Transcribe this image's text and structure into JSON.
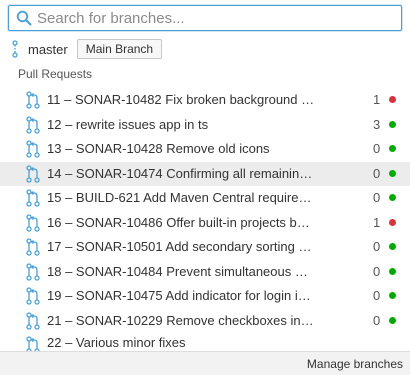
{
  "search": {
    "placeholder": "Search for branches..."
  },
  "current_branch": {
    "name": "master",
    "badge": "Main Branch"
  },
  "section": {
    "title": "Pull Requests"
  },
  "pull_requests": [
    {
      "title": "11 – SONAR-10482 Fix broken background on...",
      "count": "1",
      "status": "failed",
      "color": "#d4333f"
    },
    {
      "title": "12 – rewrite issues app in ts",
      "count": "3",
      "status": "passed",
      "color": "#00aa00"
    },
    {
      "title": "13 – SONAR-10428 Remove old icons",
      "count": "0",
      "status": "passed",
      "color": "#00aa00"
    },
    {
      "title": "14 – SONAR-10474 Confirming all remaining is...",
      "count": "0",
      "status": "passed",
      "color": "#00aa00"
    },
    {
      "title": "15 – BUILD-621 Add Maven Central requireme...",
      "count": "0",
      "status": "passed",
      "color": "#00aa00"
    },
    {
      "title": "16 – SONAR-10486 Offer built-in projects bad...",
      "count": "1",
      "status": "failed",
      "color": "#d4333f"
    },
    {
      "title": "17 – SONAR-10501 Add secondary sorting by ...",
      "count": "0",
      "status": "passed",
      "color": "#00aa00"
    },
    {
      "title": "18 – SONAR-10484 Prevent simultaneous WS ...",
      "count": "0",
      "status": "passed",
      "color": "#00aa00"
    },
    {
      "title": "19 – SONAR-10475 Add indicator for login in p...",
      "count": "0",
      "status": "passed",
      "color": "#00aa00"
    },
    {
      "title": "21 – SONAR-10229 Remove checkboxes in Is...",
      "count": "0",
      "status": "passed",
      "color": "#00aa00"
    },
    {
      "title": "22 – Various minor fixes",
      "count": "",
      "status": "",
      "color": ""
    }
  ],
  "footer": {
    "manage_label": "Manage branches"
  },
  "colors": {
    "accent": "#4b9fd5",
    "icon": "#4b9fd5",
    "passed": "#00aa00",
    "failed": "#d4333f"
  }
}
